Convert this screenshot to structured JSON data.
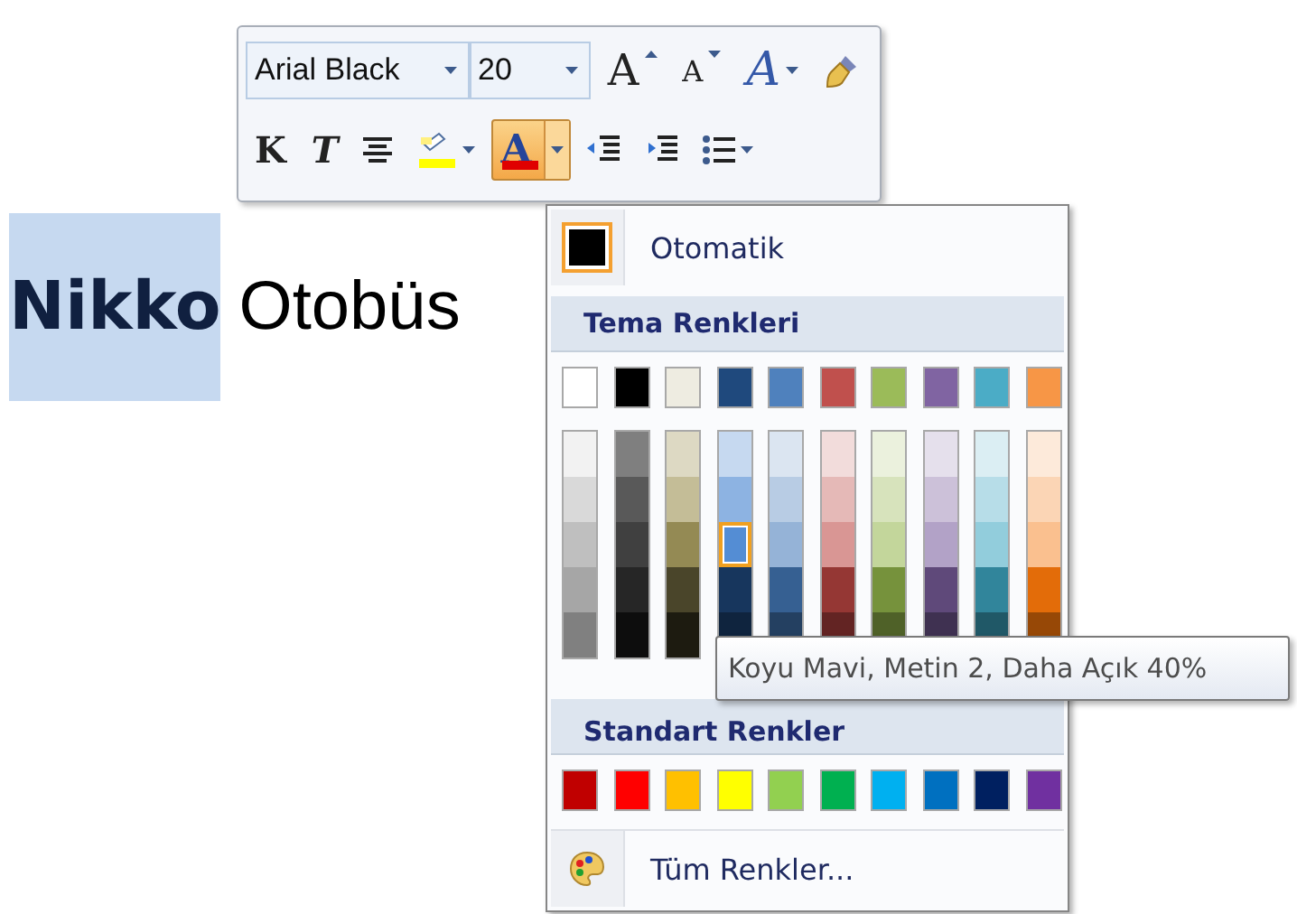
{
  "document": {
    "words": [
      {
        "text": "Nikko",
        "selected": true,
        "bold": true
      },
      {
        "text": "Otobüs",
        "selected": false,
        "bold": false
      }
    ]
  },
  "mini_toolbar": {
    "font": {
      "value": "Arial Black"
    },
    "size": {
      "value": "20"
    },
    "row_1": [
      {
        "kind": "grow",
        "glyph": "A",
        "dropdown": false
      },
      {
        "kind": "shrink",
        "glyph": "A",
        "dropdown": false
      },
      {
        "kind": "effects",
        "glyph": "A",
        "dropdown": true
      },
      {
        "kind": "painter",
        "dropdown": false
      }
    ],
    "row_2": [
      {
        "kind": "bold",
        "glyph": "K",
        "dropdown": false,
        "pressed": false
      },
      {
        "kind": "italic",
        "glyph": "T",
        "dropdown": false,
        "pressed": false
      },
      {
        "kind": "center",
        "dropdown": false,
        "pressed": false
      },
      {
        "kind": "highlight",
        "dropdown": true,
        "pressed": false,
        "color": "#ffff00"
      },
      {
        "kind": "fontcolor",
        "glyph": "A",
        "dropdown": true,
        "pressed": true,
        "color": "#e00000"
      },
      {
        "kind": "outdent",
        "dropdown": false,
        "pressed": false
      },
      {
        "kind": "indent",
        "dropdown": false,
        "pressed": false
      },
      {
        "kind": "bullets",
        "dropdown": true,
        "pressed": false
      }
    ]
  },
  "color_menu": {
    "automatic": {
      "label": "Otomatik",
      "color": "#000000"
    },
    "theme_header": "Tema Renkleri",
    "theme_colors": [
      {
        "color": "#ffffff"
      },
      {
        "color": "#000000"
      },
      {
        "color": "#eeece1"
      },
      {
        "color": "#1f497d"
      },
      {
        "color": "#4f81bd"
      },
      {
        "color": "#c0504d"
      },
      {
        "color": "#9bbb59"
      },
      {
        "color": "#8064a2"
      },
      {
        "color": "#4bacc6"
      },
      {
        "color": "#f79646"
      }
    ],
    "theme_shades": [
      {
        "shades": [
          {
            "color": "#f2f2f2",
            "selected": false
          },
          {
            "color": "#d9d9d9",
            "selected": false
          },
          {
            "color": "#bfbfbf",
            "selected": false
          },
          {
            "color": "#a6a6a6",
            "selected": false
          },
          {
            "color": "#808080",
            "selected": false
          }
        ]
      },
      {
        "shades": [
          {
            "color": "#7f7f7f",
            "selected": false
          },
          {
            "color": "#595959",
            "selected": false
          },
          {
            "color": "#404040",
            "selected": false
          },
          {
            "color": "#262626",
            "selected": false
          },
          {
            "color": "#0d0d0d",
            "selected": false
          }
        ]
      },
      {
        "shades": [
          {
            "color": "#ddd9c3",
            "selected": false
          },
          {
            "color": "#c4bd97",
            "selected": false
          },
          {
            "color": "#948a54",
            "selected": false
          },
          {
            "color": "#4a452a",
            "selected": false
          },
          {
            "color": "#1d1b10",
            "selected": false
          }
        ]
      },
      {
        "shades": [
          {
            "color": "#c6d9f0",
            "selected": false
          },
          {
            "color": "#8db3e2",
            "selected": false
          },
          {
            "color": "#548dd4",
            "selected": true
          },
          {
            "color": "#17365d",
            "selected": false
          },
          {
            "color": "#0f243e",
            "selected": false
          }
        ]
      },
      {
        "shades": [
          {
            "color": "#dbe5f1",
            "selected": false
          },
          {
            "color": "#b8cce4",
            "selected": false
          },
          {
            "color": "#95b3d7",
            "selected": false
          },
          {
            "color": "#366092",
            "selected": false
          },
          {
            "color": "#244061",
            "selected": false
          }
        ]
      },
      {
        "shades": [
          {
            "color": "#f2dcdb",
            "selected": false
          },
          {
            "color": "#e5b9b7",
            "selected": false
          },
          {
            "color": "#d99694",
            "selected": false
          },
          {
            "color": "#953734",
            "selected": false
          },
          {
            "color": "#632423",
            "selected": false
          }
        ]
      },
      {
        "shades": [
          {
            "color": "#ebf1dd",
            "selected": false
          },
          {
            "color": "#d7e3bc",
            "selected": false
          },
          {
            "color": "#c3d69b",
            "selected": false
          },
          {
            "color": "#76923c",
            "selected": false
          },
          {
            "color": "#4f6128",
            "selected": false
          }
        ]
      },
      {
        "shades": [
          {
            "color": "#e5e0ec",
            "selected": false
          },
          {
            "color": "#ccc1d9",
            "selected": false
          },
          {
            "color": "#b2a2c7",
            "selected": false
          },
          {
            "color": "#5f497a",
            "selected": false
          },
          {
            "color": "#3f3151",
            "selected": false
          }
        ]
      },
      {
        "shades": [
          {
            "color": "#dbeef3",
            "selected": false
          },
          {
            "color": "#b7dde8",
            "selected": false
          },
          {
            "color": "#92cddc",
            "selected": false
          },
          {
            "color": "#31859b",
            "selected": false
          },
          {
            "color": "#205867",
            "selected": false
          }
        ]
      },
      {
        "shades": [
          {
            "color": "#fdeada",
            "selected": false
          },
          {
            "color": "#fbd5b5",
            "selected": false
          },
          {
            "color": "#fac08f",
            "selected": false
          },
          {
            "color": "#e36c09",
            "selected": false
          },
          {
            "color": "#974806",
            "selected": false
          }
        ]
      }
    ],
    "standard_header": "Standart Renkler",
    "standard_colors": [
      {
        "color": "#c00000"
      },
      {
        "color": "#ff0000"
      },
      {
        "color": "#ffc000"
      },
      {
        "color": "#ffff00"
      },
      {
        "color": "#92d050"
      },
      {
        "color": "#00b050"
      },
      {
        "color": "#00b0f0"
      },
      {
        "color": "#0070c0"
      },
      {
        "color": "#002060"
      },
      {
        "color": "#7030a0"
      }
    ],
    "more_colors": {
      "label": "Tüm Renkler..."
    }
  },
  "tooltip": {
    "text": "Koyu Mavi, Metin 2, Daha Açık 40%"
  }
}
